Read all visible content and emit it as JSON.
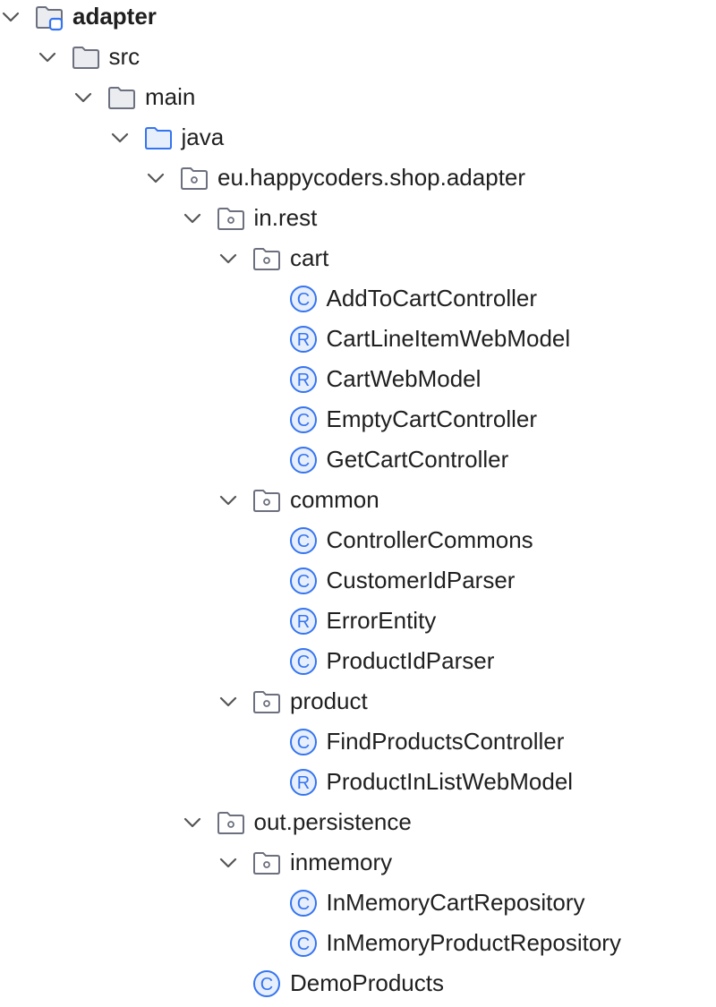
{
  "tree": {
    "nodes": [
      {
        "label": "adapter",
        "kind": "module",
        "level": 0,
        "expanded": true,
        "bold": true
      },
      {
        "label": "src",
        "kind": "folder",
        "level": 1,
        "expanded": true
      },
      {
        "label": "main",
        "kind": "folder",
        "level": 2,
        "expanded": true
      },
      {
        "label": "java",
        "kind": "source-root",
        "level": 3,
        "expanded": true
      },
      {
        "label": "eu.happycoders.shop.adapter",
        "kind": "package",
        "level": 4,
        "expanded": true
      },
      {
        "label": "in.rest",
        "kind": "package",
        "level": 5,
        "expanded": true
      },
      {
        "label": "cart",
        "kind": "package",
        "level": 6,
        "expanded": true
      },
      {
        "label": "AddToCartController",
        "kind": "class",
        "level": 7
      },
      {
        "label": "CartLineItemWebModel",
        "kind": "record",
        "level": 7
      },
      {
        "label": "CartWebModel",
        "kind": "record",
        "level": 7
      },
      {
        "label": "EmptyCartController",
        "kind": "class",
        "level": 7
      },
      {
        "label": "GetCartController",
        "kind": "class",
        "level": 7
      },
      {
        "label": "common",
        "kind": "package",
        "level": 6,
        "expanded": true
      },
      {
        "label": "ControllerCommons",
        "kind": "class",
        "level": 7
      },
      {
        "label": "CustomerIdParser",
        "kind": "class",
        "level": 7
      },
      {
        "label": "ErrorEntity",
        "kind": "record",
        "level": 7
      },
      {
        "label": "ProductIdParser",
        "kind": "class",
        "level": 7
      },
      {
        "label": "product",
        "kind": "package",
        "level": 6,
        "expanded": true
      },
      {
        "label": "FindProductsController",
        "kind": "class",
        "level": 7
      },
      {
        "label": "ProductInListWebModel",
        "kind": "record",
        "level": 7
      },
      {
        "label": "out.persistence",
        "kind": "package",
        "level": 5,
        "expanded": true
      },
      {
        "label": "inmemory",
        "kind": "package",
        "level": 6,
        "expanded": true
      },
      {
        "label": "InMemoryCartRepository",
        "kind": "class",
        "level": 7
      },
      {
        "label": "InMemoryProductRepository",
        "kind": "class",
        "level": 7
      },
      {
        "label": "DemoProducts",
        "kind": "class",
        "level": 6
      }
    ]
  },
  "icons": {
    "chevron": "chevron-down-icon",
    "module": "module-folder-icon",
    "folder": "folder-icon",
    "source-root": "source-root-folder-icon",
    "package": "package-icon",
    "class": "class-icon",
    "record": "record-icon"
  },
  "colors": {
    "text": "#1f1f1f",
    "chevron": "#555555",
    "folder_stroke": "#6c707e",
    "folder_fill": "#ebecf0",
    "source_root_stroke": "#3574f0",
    "source_root_fill": "#e7effd",
    "class_stroke": "#3574f0",
    "class_fill": "#e7effd"
  }
}
